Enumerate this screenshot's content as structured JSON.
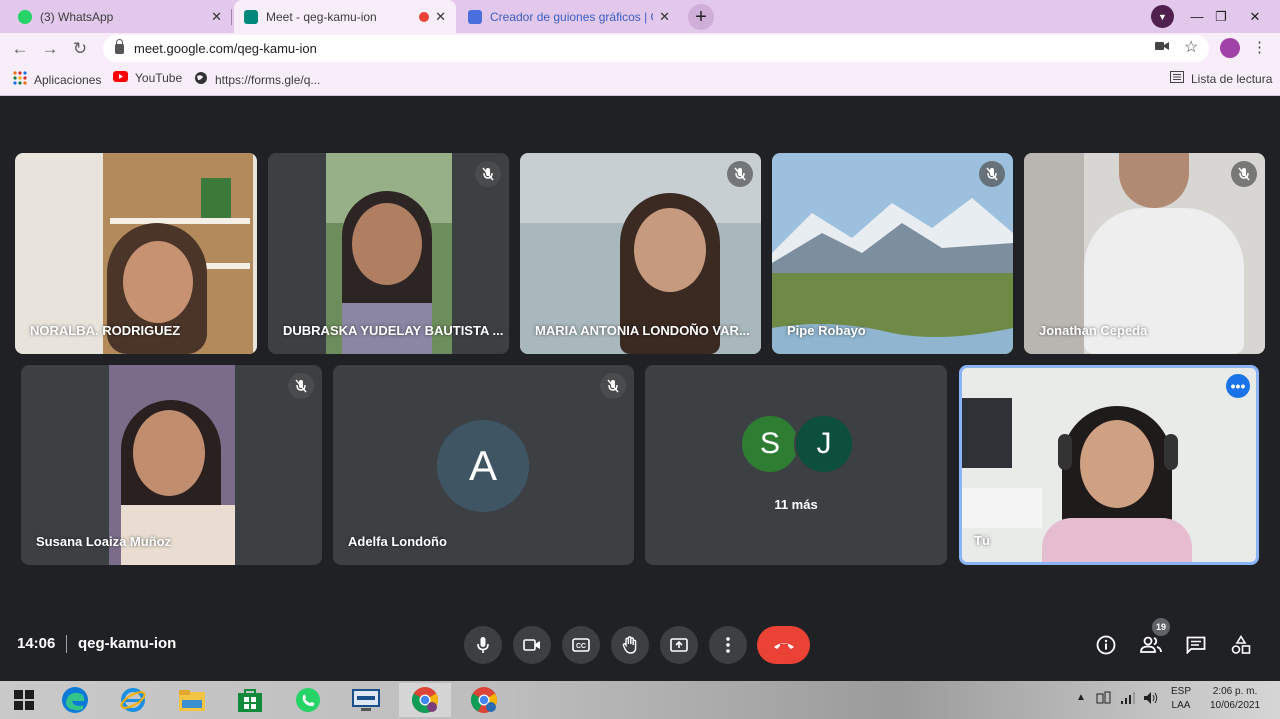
{
  "browser": {
    "tabs": [
      {
        "title": "(3) WhatsApp",
        "close": "✕",
        "favicon_color": "#25d366"
      },
      {
        "title": "Meet - qeg-kamu-ion",
        "close": "✕",
        "favicon_color": "#00897b",
        "recording": true
      },
      {
        "title": "Creador de guiones gráficos | Cre",
        "close": "✕",
        "favicon_color": "#4a6fdc"
      }
    ],
    "new_tab": "+",
    "url": "meet.google.com/qeg-kamu-ion",
    "bookmarks": [
      {
        "label": "Aplicaciones",
        "icon": "apps-grid-icon"
      },
      {
        "label": "YouTube",
        "icon": "youtube-icon"
      },
      {
        "label": "https://forms.gle/q...",
        "icon": "globe-icon"
      }
    ],
    "reading_list": "Lista de lectura",
    "window_controls": {
      "minimize": "—",
      "maximize": "❐",
      "close": "✕"
    }
  },
  "meet": {
    "participants_row1": [
      {
        "name": "NORALBA. RODRIGUEZ",
        "muted": false,
        "bg": "#d9c8b2"
      },
      {
        "name": "DUBRASKA YUDELAY BAUTISTA ...",
        "muted": true,
        "bg": "#3c4043"
      },
      {
        "name": "MARIA ANTONIA LONDOÑO VAR...",
        "muted": true,
        "bg": "#b7c3c7"
      },
      {
        "name": "Pipe Robayo",
        "muted": true,
        "bg": "#7fa2c4"
      },
      {
        "name": "Jonathan Cepeda",
        "muted": true,
        "bg": "#c9c4bd"
      }
    ],
    "participants_row2": [
      {
        "name": "Susana Loaiza Muñoz",
        "muted": true
      },
      {
        "name": "Adelfa Londoño",
        "muted": true,
        "initial": "A"
      },
      {
        "more": "11 más",
        "initials": [
          "S",
          "J"
        ]
      },
      {
        "name": "Tú",
        "self": true,
        "menu": "•••"
      }
    ],
    "time": "14:06",
    "meeting_code": "qeg-kamu-ion",
    "participant_count": "19",
    "controls": [
      "microphone-icon",
      "camera-icon",
      "captions-icon",
      "raise-hand-icon",
      "present-icon",
      "more-options-icon",
      "hang-up-icon"
    ],
    "right_controls": [
      "info-icon",
      "people-icon",
      "chat-icon",
      "activities-icon"
    ]
  },
  "taskbar": {
    "lang": "ESP",
    "layout": "LAA",
    "clock_time": "2:06 p. m.",
    "clock_date": "10/06/2021"
  },
  "colors": {
    "stage_bg": "#202124",
    "tile_bg": "#3c4043",
    "hangup": "#ea4335",
    "accent_blue": "#1a73e8",
    "tab_strip": "#e2c8ea"
  }
}
